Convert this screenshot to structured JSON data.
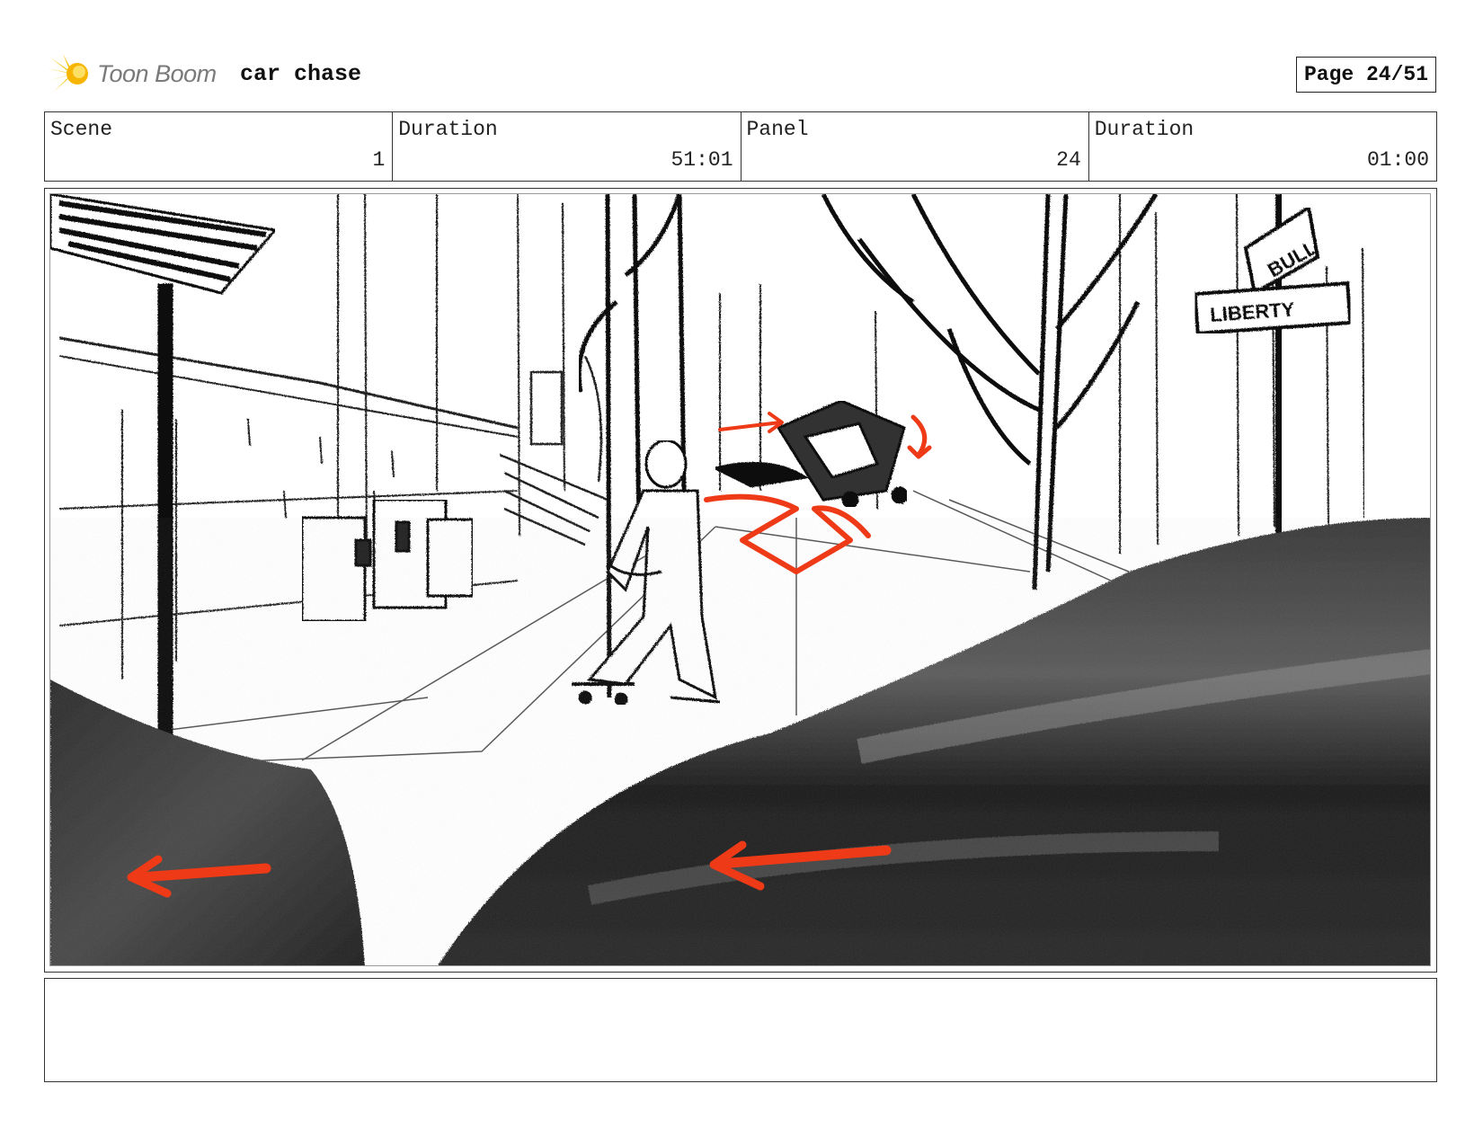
{
  "header": {
    "logo_text": "Toon Boom",
    "project_title": "car chase",
    "page_label": "Page 24/51"
  },
  "info": {
    "scene_label": "Scene",
    "scene_value": "1",
    "scene_duration_label": "Duration",
    "scene_duration_value": "51:01",
    "panel_label": "Panel",
    "panel_value": "24",
    "panel_duration_label": "Duration",
    "panel_duration_value": "01:00"
  },
  "panel": {
    "sign_top": "BULL",
    "sign_bottom": "LIBERTY",
    "accent_color": "#ee3a17"
  },
  "notes": {
    "text": ""
  }
}
